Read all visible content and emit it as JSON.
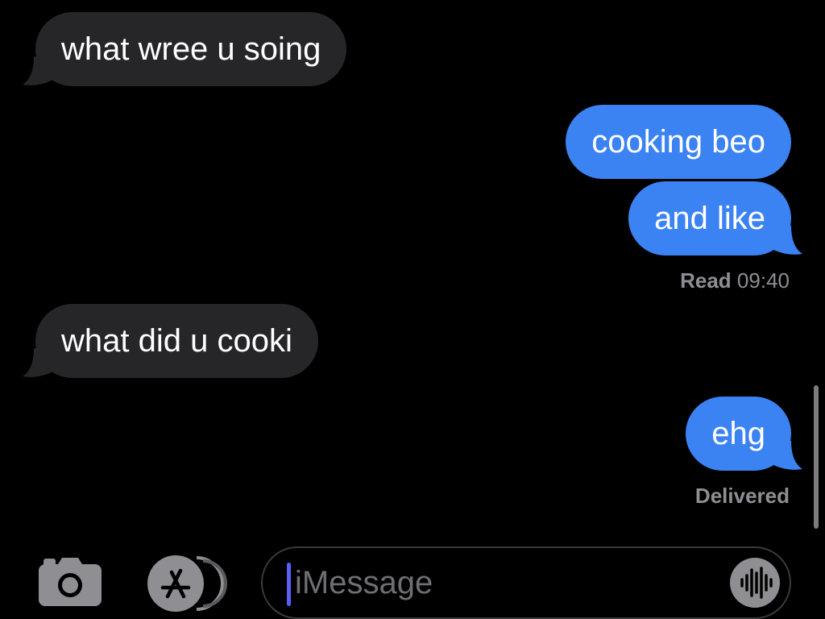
{
  "conversation": {
    "messages": [
      {
        "direction": "incoming",
        "text": "what wree u soing"
      },
      {
        "direction": "outgoing",
        "text": "cooking beo"
      },
      {
        "direction": "outgoing",
        "text": "and like"
      },
      {
        "direction": "incoming",
        "text": "what did u cooki"
      },
      {
        "direction": "outgoing",
        "text": "ehg"
      }
    ],
    "read_receipt": {
      "status": "Read",
      "time": "09:40"
    },
    "delivered_receipt": "Delivered"
  },
  "composer": {
    "placeholder": "iMessage",
    "icons": {
      "camera": "camera-icon",
      "apps": "app-store-icon",
      "audio": "audio-waveform-icon"
    }
  },
  "colors": {
    "background": "#000000",
    "incoming_bubble": "#262629",
    "outgoing_bubble": "#3b82f3",
    "receipt_text": "#8e8e93",
    "cursor": "#5a5ff5"
  }
}
